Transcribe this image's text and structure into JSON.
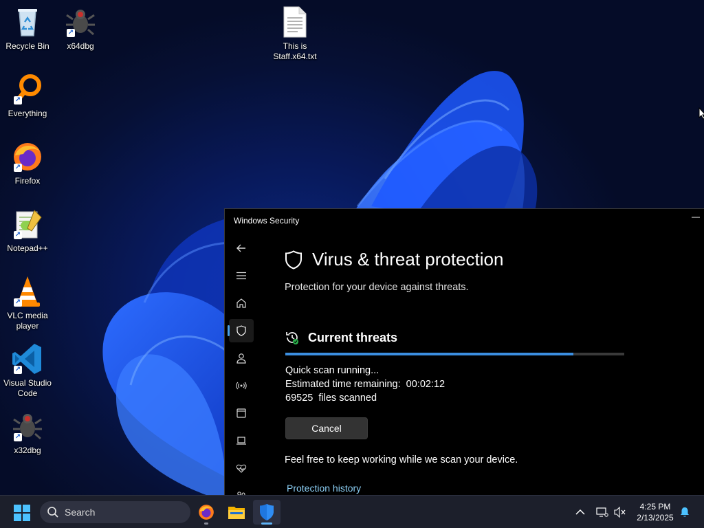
{
  "desktop": {
    "icons": [
      {
        "label": "Recycle Bin"
      },
      {
        "label": "x64dbg"
      },
      {
        "label": "This is Staff.x64.txt"
      },
      {
        "label": "Everything"
      },
      {
        "label": "Firefox"
      },
      {
        "label": "Notepad++"
      },
      {
        "label": "VLC media player"
      },
      {
        "label": "Visual Studio Code"
      },
      {
        "label": "x32dbg"
      }
    ]
  },
  "window": {
    "title": "Windows Security",
    "minimize_glyph": "—",
    "page_title": "Virus & threat protection",
    "page_subtitle": "Protection for your device against threats.",
    "section_title": "Current threats",
    "scan": {
      "status": "Quick scan running...",
      "time_remaining": "Estimated time remaining:  00:02:12",
      "files_scanned": "69525  files scanned",
      "progress": 0.85
    },
    "cancel_label": "Cancel",
    "info_text": "Feel free to keep working while we scan your device.",
    "history_link": "Protection history",
    "nav": [
      {
        "icon": "back-arrow-icon"
      },
      {
        "icon": "hamburger-menu-icon"
      },
      {
        "icon": "home-icon"
      },
      {
        "icon": "shield-icon",
        "active": true
      },
      {
        "icon": "account-icon"
      },
      {
        "icon": "network-icon"
      },
      {
        "icon": "app-browser-icon"
      },
      {
        "icon": "device-security-icon"
      },
      {
        "icon": "device-health-icon"
      },
      {
        "icon": "family-icon"
      }
    ]
  },
  "taskbar": {
    "search_label": "Search",
    "time": "4:25 PM",
    "date": "2/13/2025"
  },
  "colors": {
    "accent": "#3b8ee0",
    "link": "#8ccff5",
    "window_bg": "#000000"
  }
}
